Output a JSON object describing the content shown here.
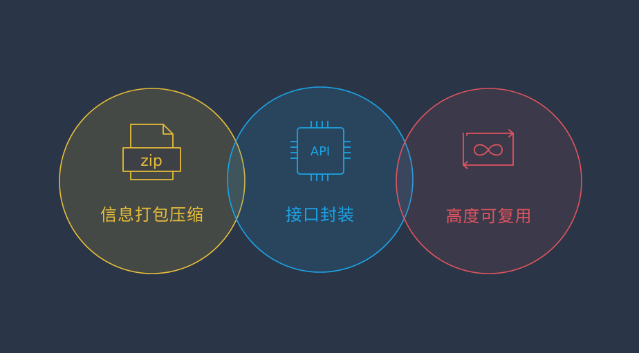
{
  "colors": {
    "background": "#2a3648",
    "yellow": "#e7bd3a",
    "blue": "#1ca4e6",
    "red": "#e0545e"
  },
  "circles": [
    {
      "id": "info-packaging",
      "label": "信息打包压缩",
      "icon": "zip-file-icon",
      "icon_text": "zip",
      "color": "#e7bd3a"
    },
    {
      "id": "interface-encapsulation",
      "label": "接口封装",
      "icon": "api-chip-icon",
      "icon_text": "API",
      "color": "#1ca4e6"
    },
    {
      "id": "high-reusability",
      "label": "高度可复用",
      "icon": "infinity-loop-icon",
      "icon_text": "",
      "color": "#e0545e"
    }
  ]
}
